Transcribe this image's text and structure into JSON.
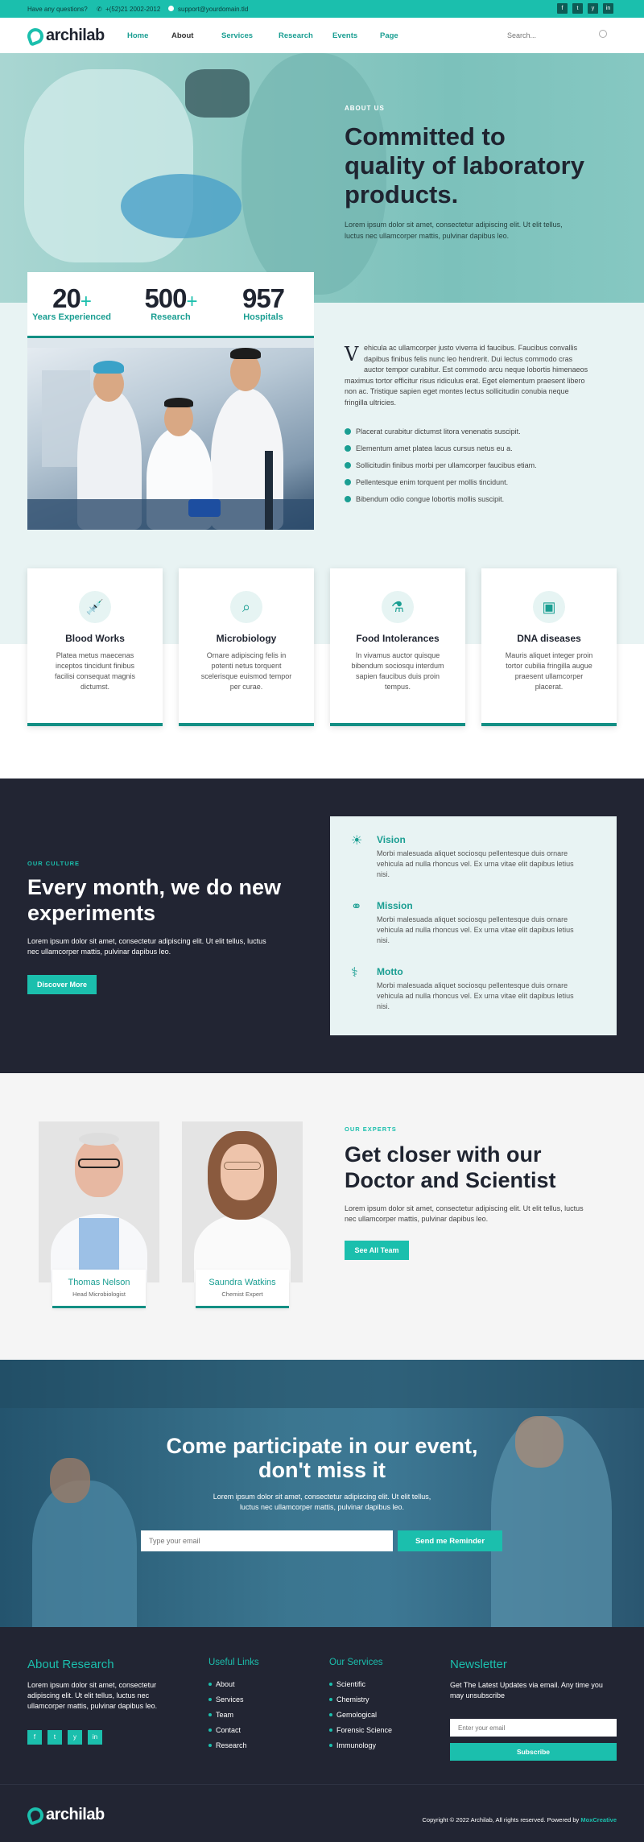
{
  "topbar": {
    "question": "Have any questions?",
    "phone": "+(52)21 2002-2012",
    "email": "support@yourdomain.tld",
    "social": [
      "f",
      "t",
      "y",
      "in"
    ]
  },
  "brand": {
    "name": "archilab"
  },
  "nav": {
    "items": [
      "Home",
      "About",
      "Services",
      "Research",
      "Events",
      "Page"
    ],
    "search_placeholder": "Search..."
  },
  "hero": {
    "eyebrow": "ABOUT US",
    "title_l1": "Committed to",
    "title_l2": "quality of laboratory",
    "title_l3": "products.",
    "text_l1": "Lorem ipsum dolor sit amet, consectetur adipiscing elit. Ut elit tellus,",
    "text_l2": "luctus nec ullamcorper mattis, pulvinar dapibus leo."
  },
  "stats": [
    {
      "num": "20",
      "plus": "+",
      "label": "Years Experienced"
    },
    {
      "num": "500",
      "plus": "+",
      "label": "Research"
    },
    {
      "num": "957",
      "plus": "",
      "label": "Hospitals"
    }
  ],
  "about": {
    "dropcap": "V",
    "para_l1": "ehicula ac ullamcorper justo viverra id faucibus. Faucibus convallis",
    "para_l2": "dapibus finibus felis nunc leo hendrerit. Dui lectus commodo cras",
    "para_l3": "auctor tempor curabitur. Est commodo arcu neque lobortis himenaeos",
    "para_l4": "maximus tortor efficitur risus ridiculus erat. Eget elementum praesent libero",
    "para_l5": "non ac. Tristique sapien eget montes lectus sollicitudin conubia neque",
    "para_l6": "fringilla ultricies.",
    "checks": [
      "Placerat curabitur dictumst litora venenatis suscipit.",
      "Elementum amet platea lacus cursus netus eu a.",
      "Sollicitudin finibus morbi per ullamcorper faucibus etiam.",
      "Pellentesque enim torquent per mollis tincidunt.",
      "Bibendum odio congue lobortis mollis suscipit."
    ]
  },
  "services": [
    {
      "icon": "syringe-icon",
      "title": "Blood Works",
      "l1": "Platea metus maecenas",
      "l2": "inceptos tincidunt finibus",
      "l3": "facilisi consequat magnis",
      "l4": "dictumst."
    },
    {
      "icon": "magnifier-icon",
      "title": "Microbiology",
      "l1": "Ornare adipiscing felis in",
      "l2": "potenti netus torquent",
      "l3": "scelerisque euismod tempor",
      "l4": "per curae."
    },
    {
      "icon": "food-icon",
      "title": "Food Intolerances",
      "l1": "In vivamus auctor quisque",
      "l2": "bibendum sociosqu interdum",
      "l3": "sapien faucibus duis proin",
      "l4": "tempus."
    },
    {
      "icon": "dna-icon",
      "title": "DNA diseases",
      "l1": "Mauris aliquet integer proin",
      "l2": "tortor cubilia fringilla augue",
      "l3": "praesent ullamcorper",
      "l4": "placerat."
    }
  ],
  "culture": {
    "eyebrow": "OUR CULTURE",
    "title_l1": "Every month, we do new",
    "title_l2": "experiments",
    "text_l1": "Lorem ipsum dolor sit amet, consectetur adipiscing elit. Ut elit tellus, luctus",
    "text_l2": "nec ullamcorper mattis, pulvinar dapibus leo.",
    "button": "Discover More",
    "values": [
      {
        "icon": "bulb-icon",
        "title": "Vision",
        "l1": "Morbi malesuada aliquet sociosqu pellentesque duis ornare",
        "l2": "vehicula ad nulla rhoncus vel. Ex urna vitae elit dapibus letius",
        "l3": "nisi."
      },
      {
        "icon": "molecule-icon",
        "title": "Mission",
        "l1": "Morbi malesuada aliquet sociosqu pellentesque duis ornare",
        "l2": "vehicula ad nulla rhoncus vel. Ex urna vitae elit dapibus letius",
        "l3": "nisi."
      },
      {
        "icon": "caduceus-icon",
        "title": "Motto",
        "l1": "Morbi malesuada aliquet sociosqu pellentesque duis ornare",
        "l2": "vehicula ad nulla rhoncus vel. Ex urna vitae elit dapibus letius",
        "l3": "nisi."
      }
    ]
  },
  "experts": {
    "eyebrow": "OUR EXPERTS",
    "title_l1": "Get closer with our",
    "title_l2": "Doctor and Scientist",
    "text_l1": "Lorem ipsum dolor sit amet, consectetur adipiscing elit. Ut elit tellus, luctus",
    "text_l2": "nec ullamcorper mattis, pulvinar dapibus leo.",
    "button": "See All Team",
    "people": [
      {
        "name": "Thomas Nelson",
        "role": "Head Microbiologist"
      },
      {
        "name": "Saundra Watkins",
        "role": "Chemist Expert"
      }
    ]
  },
  "event": {
    "title_l1": "Come participate in our event,",
    "title_l2": "don't miss it",
    "text_l1": "Lorem ipsum dolor sit amet, consectetur adipiscing elit. Ut elit tellus,",
    "text_l2": "luctus nec ullamcorper mattis, pulvinar dapibus leo.",
    "email_placeholder": "Type your email",
    "button": "Send me Reminder"
  },
  "footer": {
    "about_title": "About Research",
    "about_l1": "Lorem ipsum dolor sit amet, consectetur",
    "about_l2": "adipiscing elit. Ut elit tellus, luctus nec",
    "about_l3": "ullamcorper mattis, pulvinar dapibus leo.",
    "links_title": "Useful Links",
    "links": [
      "About",
      "Services",
      "Team",
      "Contact",
      "Research"
    ],
    "services_title": "Our Services",
    "services": [
      "Scientific",
      "Chemistry",
      "Gemological",
      "Forensic Science",
      "Immunology"
    ],
    "newsletter_title": "Newsletter",
    "newsletter_l1": "Get The Latest Updates via email. Any time you",
    "newsletter_l2": "may unsubscribe",
    "newsletter_placeholder": "Enter your email",
    "newsletter_button": "Subscribe",
    "copyright": "Copyright © 2022 Archilab, All rights reserved. Powered by",
    "powered": "MoxCreative"
  }
}
